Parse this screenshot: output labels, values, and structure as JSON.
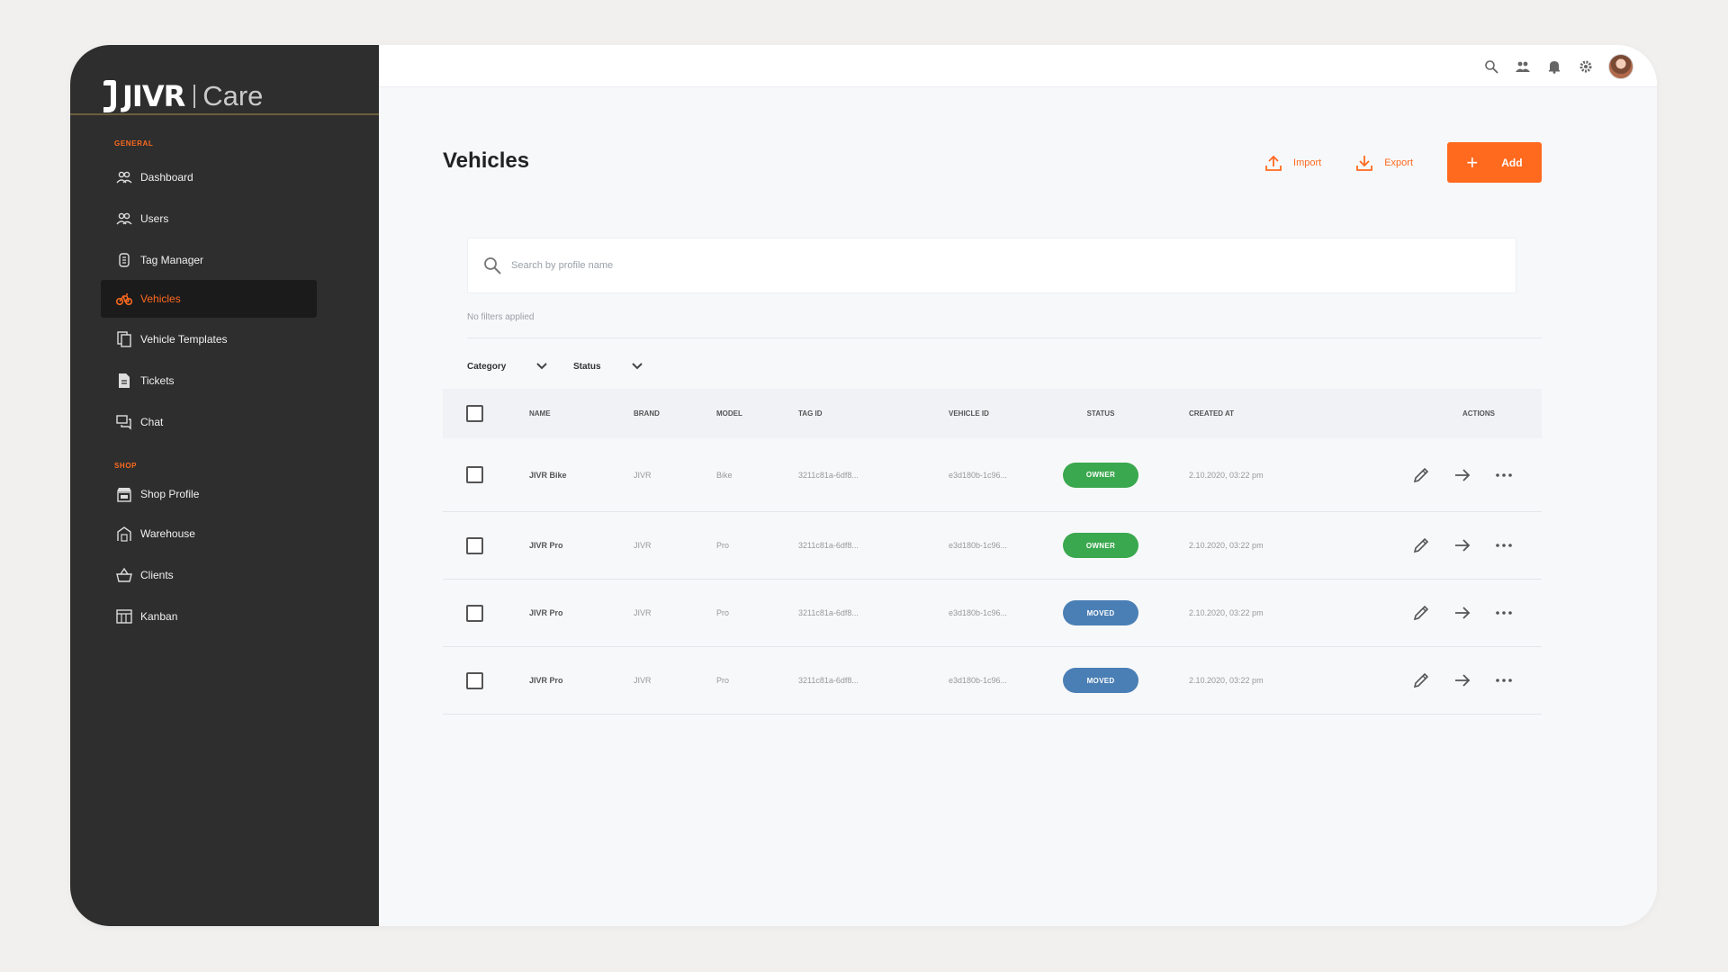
{
  "brand": {
    "name": "JIVR",
    "sub": "Care"
  },
  "sidebar": {
    "general_label": "General",
    "shop_label": "Shop",
    "items": [
      {
        "label": "Dashboard",
        "icon": "dashboard-icon"
      },
      {
        "label": "Users",
        "icon": "users-icon"
      },
      {
        "label": "Tag Manager",
        "icon": "tag-icon"
      },
      {
        "label": "Vehicles",
        "icon": "bike-icon",
        "active": true
      },
      {
        "label": "Vehicle Templates",
        "icon": "templates-icon"
      },
      {
        "label": "Tickets",
        "icon": "ticket-icon"
      },
      {
        "label": "Chat",
        "icon": "chat-icon"
      }
    ],
    "shop_items": [
      {
        "label": "Shop Profile",
        "icon": "shop-icon"
      },
      {
        "label": "Warehouse",
        "icon": "warehouse-icon"
      },
      {
        "label": "Clients",
        "icon": "basket-icon"
      },
      {
        "label": "Kanban",
        "icon": "kanban-icon"
      }
    ]
  },
  "header": {
    "title": "Vehicles",
    "import_label": "Import",
    "export_label": "Export",
    "add_label": "Add"
  },
  "search": {
    "placeholder": "Search by profile name"
  },
  "filters": {
    "note": "No filters applied",
    "category_label": "Category",
    "status_label": "Status"
  },
  "table": {
    "columns": [
      "Name",
      "Brand",
      "Model",
      "Tag ID",
      "Vehicle ID",
      "Status",
      "Created At",
      "Actions"
    ],
    "rows": [
      {
        "name": "JIVR Bike",
        "brand": "JIVR",
        "model": "Bike",
        "tag_id": "3211c81a-6df8...",
        "vehicle_id": "e3d180b-1c96...",
        "status": "OWNER",
        "created_at": "2.10.2020, 03:22 pm"
      },
      {
        "name": "JIVR Pro",
        "brand": "JIVR",
        "model": "Pro",
        "tag_id": "3211c81a-6df8...",
        "vehicle_id": "e3d180b-1c96...",
        "status": "OWNER",
        "created_at": "2.10.2020, 03:22 pm"
      },
      {
        "name": "JIVR Pro",
        "brand": "JIVR",
        "model": "Pro",
        "tag_id": "3211c81a-6df8...",
        "vehicle_id": "e3d180b-1c96...",
        "status": "MOVED",
        "created_at": "2.10.2020, 03:22 pm"
      },
      {
        "name": "JIVR Pro",
        "brand": "JIVR",
        "model": "Pro",
        "tag_id": "3211c81a-6df8...",
        "vehicle_id": "e3d180b-1c96...",
        "status": "MOVED",
        "created_at": "2.10.2020, 03:22 pm"
      }
    ]
  },
  "colors": {
    "accent": "#ff6a1f",
    "owner": "#3aa84e",
    "moved": "#4a7fb5",
    "sidebar_bg": "#2e2e2e"
  }
}
